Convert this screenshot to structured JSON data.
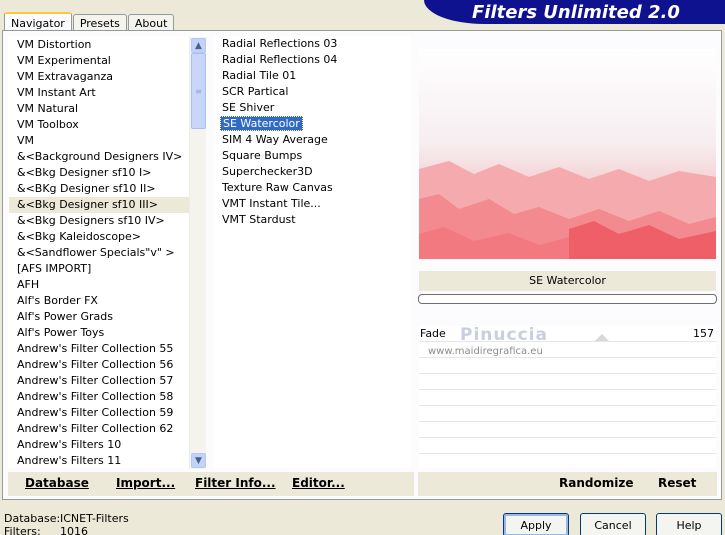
{
  "tabs": [
    "Navigator",
    "Presets",
    "About"
  ],
  "banner_title": "Filters Unlimited 2.0",
  "categories": [
    "VM Distortion",
    "VM Experimental",
    "VM Extravaganza",
    "VM Instant Art",
    "VM Natural",
    "VM Toolbox",
    "VM",
    "&<Background Designers IV>",
    "&<Bkg Designer sf10 I>",
    "&<BKg Designer sf10 II>",
    "&<Bkg Designer sf10 III>",
    "&<Bkg Designers sf10 IV>",
    "&<Bkg Kaleidoscope>",
    "&<Sandflower Specials\"v\" >",
    "[AFS IMPORT]",
    "AFH",
    "Alf's Border FX",
    "Alf's Power Grads",
    "Alf's Power Toys",
    "Andrew's Filter Collection 55",
    "Andrew's Filter Collection 56",
    "Andrew's Filter Collection 57",
    "Andrew's Filter Collection 58",
    "Andrew's Filter Collection 59",
    "Andrew's Filter Collection 62",
    "Andrew's Filters 10",
    "Andrew's Filters 11"
  ],
  "selected_category": "&<Bkg Designer sf10 III>",
  "filters": [
    "Radial Reflections 03",
    "Radial Reflections 04",
    "Radial Tile 01",
    "SCR  Partical",
    "SE Shiver",
    "SE Watercolor",
    "SIM 4 Way Average",
    "Square Bumps",
    "Superchecker3D",
    "Texture Raw Canvas",
    "VMT Instant Tile...",
    "VMT Stardust"
  ],
  "selected_filter": "SE Watercolor",
  "preview_filter_name": "SE Watercolor",
  "slider": {
    "label": "Fade",
    "value": "157"
  },
  "watermark": {
    "name": "Pinuccia",
    "url": "www.maidiregrafica.eu"
  },
  "toolbar": {
    "database": "Database",
    "import": "Import...",
    "filter_info": "Filter Info...",
    "editor": "Editor..."
  },
  "right_toolbar": {
    "randomize": "Randomize",
    "reset": "Reset"
  },
  "status": {
    "database_label": "Database:",
    "database_value": "ICNET-Filters",
    "filters_label": "Filters:",
    "filters_value": "1016"
  },
  "dialog": {
    "apply": "Apply",
    "cancel": "Cancel",
    "help": "Help"
  },
  "icons": {
    "scroll_up": "chevron-up-icon",
    "scroll_down": "chevron-down-icon"
  }
}
